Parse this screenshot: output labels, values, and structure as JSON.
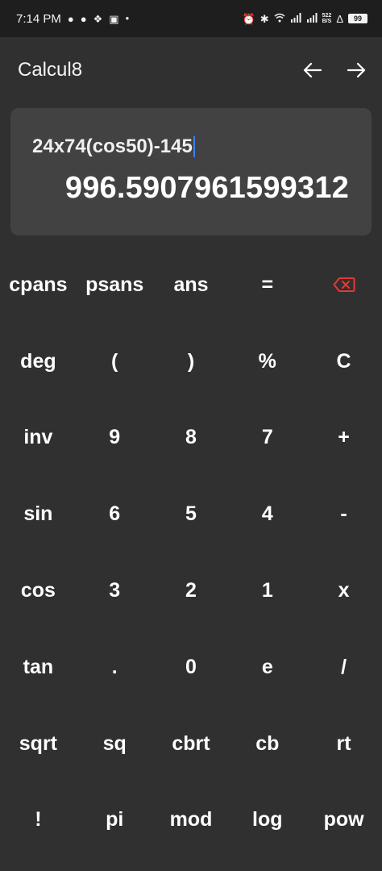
{
  "status_bar": {
    "time": "7:14 PM",
    "net_speed_value": "522",
    "net_speed_unit": "B/S",
    "battery": "99"
  },
  "app": {
    "title": "Calcul8",
    "back_icon": "arrow-left-icon",
    "forward_icon": "arrow-right-icon"
  },
  "display": {
    "expression": "24x74(cos50)-145",
    "result": "996.5907961599312"
  },
  "colors": {
    "background": "#303030",
    "status_bar": "#1e1e1e",
    "display_card": "#424242",
    "cursor": "#3b82f6",
    "backspace": "#e53935"
  },
  "keypad": {
    "rows": [
      [
        "cpans",
        "psans",
        "ans",
        "=",
        ""
      ],
      [
        "deg",
        "(",
        ")",
        "%",
        "C"
      ],
      [
        "inv",
        "9",
        "8",
        "7",
        "+"
      ],
      [
        "sin",
        "6",
        "5",
        "4",
        "-"
      ],
      [
        "cos",
        "3",
        "2",
        "1",
        "x"
      ],
      [
        "tan",
        ".",
        "0",
        "e",
        "/"
      ],
      [
        "sqrt",
        "sq",
        "cbrt",
        "cb",
        "rt"
      ],
      [
        "!",
        "pi",
        "mod",
        "log",
        "pow"
      ]
    ],
    "backspace_icon": "backspace-icon"
  }
}
